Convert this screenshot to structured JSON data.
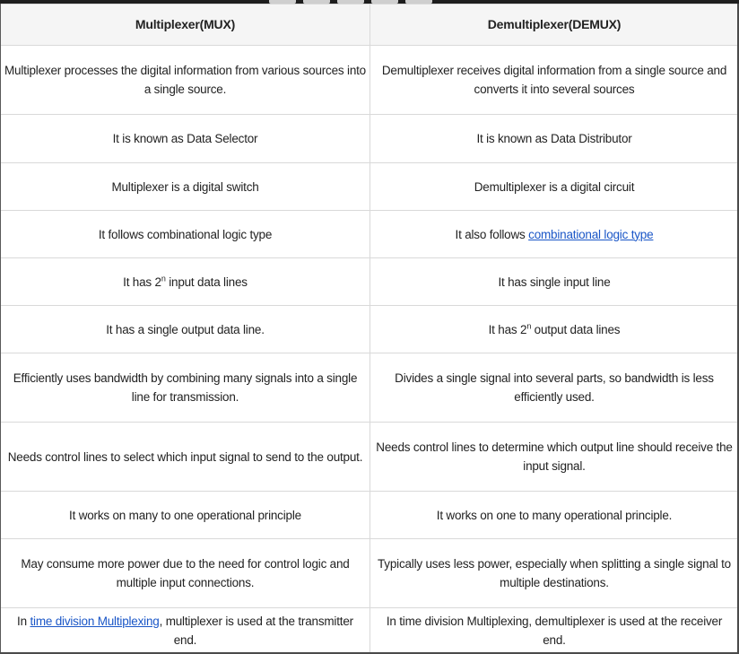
{
  "table": {
    "headers": [
      "Multiplexer(MUX)",
      "Demultiplexer(DEMUX)"
    ],
    "rows": [
      {
        "mux": "Multiplexer processes the digital information from various sources into a single source.",
        "demux": "Demultiplexer receives digital information from a single source and converts it into several sources"
      },
      {
        "mux": "It is known as Data Selector",
        "demux": "It is known as Data Distributor"
      },
      {
        "mux": "Multiplexer is a digital switch",
        "demux": "Demultiplexer is a digital circuit"
      },
      {
        "mux": "It follows combinational logic type",
        "demux_prefix": "It also follows ",
        "demux_link": "combinational logic type"
      },
      {
        "mux_prefix": "It has 2",
        "mux_sup": "n",
        "mux_suffix": " input data lines",
        "demux": "It has single input line"
      },
      {
        "mux": "It has a single output data line.",
        "demux_prefix": "It has 2",
        "demux_sup": "n",
        "demux_suffix": " output data lines"
      },
      {
        "mux": "Efficiently uses bandwidth by combining many signals into a single line for transmission.",
        "demux": "Divides a single signal into several parts, so bandwidth is less efficiently used."
      },
      {
        "mux": "Needs control lines to select which input signal to send to the output.",
        "demux": "Needs control lines to determine which output line should receive the input signal."
      },
      {
        "mux": "It works on many to one operational principle",
        "demux": "It works on one to many operational principle."
      },
      {
        "mux": "May consume more power due to the need for control logic and multiple input connections.",
        "demux": "Typically uses less power, especially when splitting a single signal to multiple destinations."
      },
      {
        "mux_prefix": "In ",
        "mux_link": "time division Multiplexing",
        "mux_suffix": ", multiplexer is used at the transmitter end.",
        "demux": "In time division Multiplexing, demultiplexer is used at the receiver end."
      }
    ]
  },
  "colors": {
    "link": "#1a56c7",
    "header_bg": "#f5f5f5",
    "border": "#d9d9d9",
    "text": "#222222"
  }
}
